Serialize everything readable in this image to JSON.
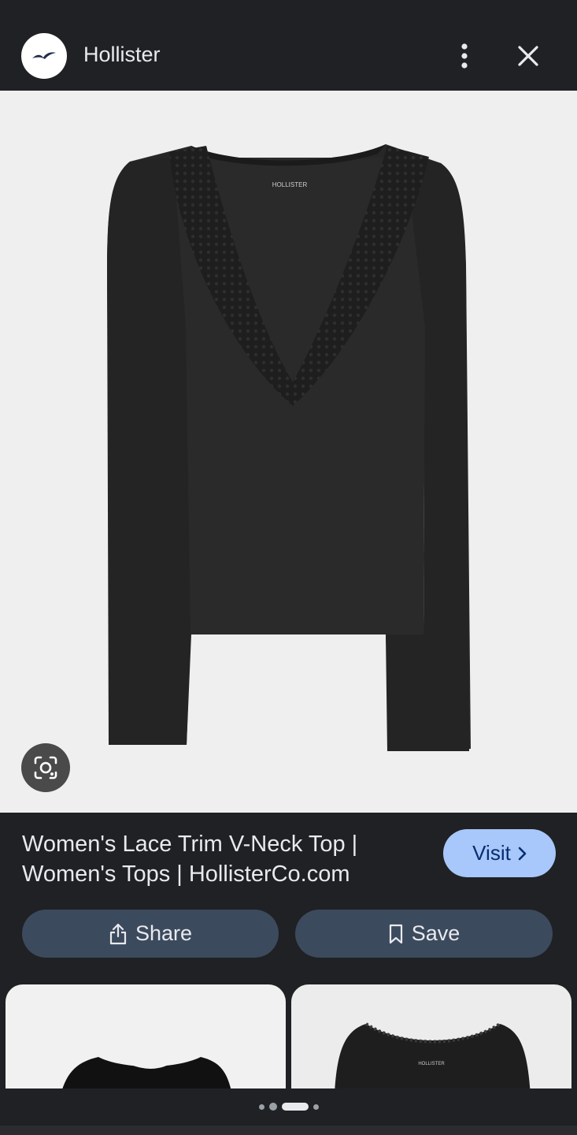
{
  "header": {
    "site_name": "Hollister",
    "logo_icon": "hollister-seagull-icon",
    "menu_icon": "more-vert-icon",
    "close_icon": "close-icon"
  },
  "image": {
    "product": "black long-sleeve lace trim v-neck top",
    "neck_label": "HOLLISTER",
    "lens_icon": "google-lens-icon"
  },
  "result": {
    "title": "Women's Lace Trim V-Neck Top | Women's Tops | HollisterCo.com",
    "visit_label": "Visit",
    "visit_icon": "chevron-right-icon"
  },
  "actions": {
    "share_label": "Share",
    "share_icon": "share-icon",
    "save_label": "Save",
    "save_icon": "bookmark-icon"
  },
  "related": {
    "items": [
      {
        "product": "black top"
      },
      {
        "product": "black lace scoop-neck top",
        "neck_label": "HOLLISTER"
      }
    ]
  },
  "pager": {
    "count": 4,
    "active_index": 2
  },
  "colors": {
    "background": "#202124",
    "visit_button": "#a8c7fa",
    "action_button": "#3c4a5e"
  }
}
